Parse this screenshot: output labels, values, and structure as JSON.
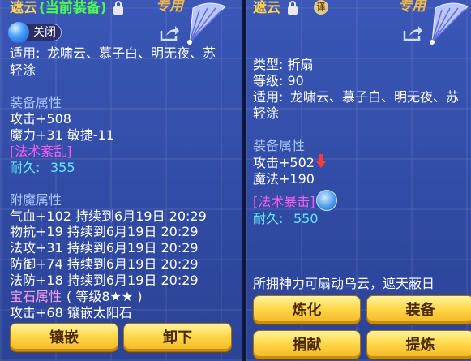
{
  "left_panel": {
    "item_name": "遮云",
    "equipped_tag": "(当前装备)",
    "special_tag": "专用",
    "close_label": "关闭",
    "usable_by_label": "适用:",
    "usable_by": "龙啸云、慕子白、明无夜、苏",
    "usable_by_cont": "轻涂",
    "equip_attr_header": "装备属性",
    "attack": "攻击+508",
    "magic_agility": "魔力+31 敏捷-11",
    "spell": "[法术紊乱]",
    "durability_label": "耐久:",
    "durability_value": "355",
    "enchant_header": "附魔属性",
    "enchant_lines": [
      "气血+102 持续到6月19日 20:29",
      "物抗+19 持续到6月19日 20:29",
      "法攻+31 持续到6月19日 20:29",
      "防御+74 持续到6月19日 20:29",
      "法防+18 持续到6月19日 20:29"
    ],
    "gem_header": "宝石属性",
    "gem_level": "( 等级8★★ )",
    "gem_line": "攻击+68 镶嵌太阳石",
    "buttons": {
      "inlay": "镶嵌",
      "unequip": "卸下"
    }
  },
  "right_panel": {
    "item_name": "遮云",
    "bind_badge": "译",
    "special_tag": "专用",
    "type_line": "类型: 折扇",
    "level_line": "等级: 90",
    "usable_by_label": "适用:",
    "usable_by": "龙啸云、慕子白、明无夜、苏",
    "usable_by_cont": "轻涂",
    "equip_attr_header": "装备属性",
    "attack": "攻击+502",
    "magic": "魔法+190",
    "spell": "[法术暴击]",
    "durability_label": "耐久:",
    "durability_value": "550",
    "description": "所拥神力可扇动乌云，遮天蔽日",
    "buttons": {
      "refine": "炼化",
      "equip": "装备",
      "donate": "捐献",
      "extract": "提炼"
    }
  },
  "icons": [
    "lock-icon",
    "share-icon",
    "fan-icon",
    "close-icon",
    "down-arrow-icon",
    "spell-icon"
  ],
  "colors": {
    "panel_bg": "#3450ab",
    "title_gold": "#ffd34d",
    "equipped_green": "#4cff4c",
    "section_header": "#a9c7ff",
    "spell_magenta": "#ff5df0",
    "durability_cyan": "#5fe8ff",
    "button_gold": "#ffd84a"
  }
}
